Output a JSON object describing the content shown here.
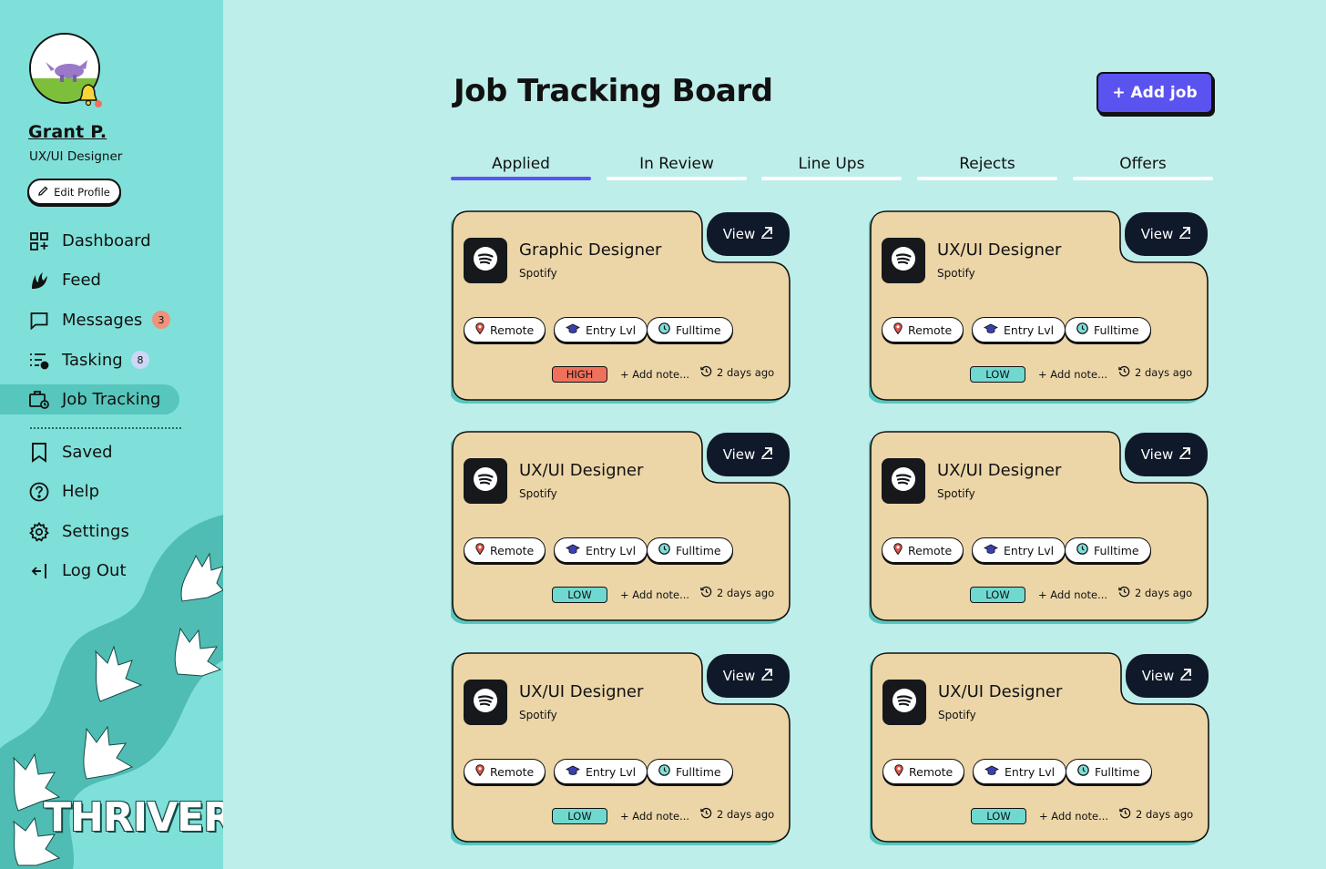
{
  "profile": {
    "name": "Grant P.",
    "role": "UX/UI Designer",
    "edit_label": "Edit Profile"
  },
  "nav": {
    "dashboard": "Dashboard",
    "feed": "Feed",
    "messages": "Messages",
    "messages_count": "3",
    "tasking": "Tasking",
    "tasking_count": "8",
    "job_tracking": "Job Tracking",
    "saved": "Saved",
    "help": "Help",
    "settings": "Settings",
    "logout": "Log Out"
  },
  "brand": "THRIVER",
  "header": {
    "title": "Job Tracking Board",
    "add_job_label": "+ Add job"
  },
  "tabs": [
    "Applied",
    "In Review",
    "Line Ups",
    "Rejects",
    "Offers"
  ],
  "active_tab": "Applied",
  "jobs": [
    {
      "title": "Graphic Designer",
      "company": "Spotify",
      "location": "Remote",
      "level": "Entry Lvl",
      "type": "Fulltime",
      "priority": "HIGH",
      "note": "+ Add note...",
      "time": "2 days ago",
      "view": "View"
    },
    {
      "title": "UX/UI Designer",
      "company": "Spotify",
      "location": "Remote",
      "level": "Entry Lvl",
      "type": "Fulltime",
      "priority": "LOW",
      "note": "+ Add note...",
      "time": "2 days ago",
      "view": "View"
    },
    {
      "title": "UX/UI Designer",
      "company": "Spotify",
      "location": "Remote",
      "level": "Entry Lvl",
      "type": "Fulltime",
      "priority": "LOW",
      "note": "+ Add note...",
      "time": "2 days ago",
      "view": "View"
    },
    {
      "title": "UX/UI Designer",
      "company": "Spotify",
      "location": "Remote",
      "level": "Entry Lvl",
      "type": "Fulltime",
      "priority": "LOW",
      "note": "+ Add note...",
      "time": "2 days ago",
      "view": "View"
    },
    {
      "title": "UX/UI Designer",
      "company": "Spotify",
      "location": "Remote",
      "level": "Entry Lvl",
      "type": "Fulltime",
      "priority": "LOW",
      "note": "+ Add note...",
      "time": "2 days ago",
      "view": "View"
    },
    {
      "title": "UX/UI Designer",
      "company": "Spotify",
      "location": "Remote",
      "level": "Entry Lvl",
      "type": "Fulltime",
      "priority": "LOW",
      "note": "+ Add note...",
      "time": "2 days ago",
      "view": "View"
    }
  ],
  "colors": {
    "background": "#bdeeea",
    "sidebar": "#7fe0d9",
    "card": "#ecd6a8",
    "accent": "#5b53f0",
    "high": "#f0715b",
    "low": "#6fd9d0"
  }
}
